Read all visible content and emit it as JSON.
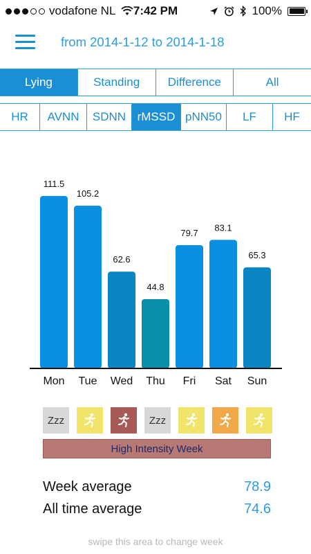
{
  "status_bar": {
    "carrier": "vodafone NL",
    "time": "7:42 PM",
    "battery": "100%",
    "signal_dots": 3,
    "signal_total": 5
  },
  "header": {
    "date_range": "from 2014-1-12 to 2014-1-18"
  },
  "position_tabs": [
    {
      "label": "Lying",
      "active": true
    },
    {
      "label": "Standing",
      "active": false
    },
    {
      "label": "Difference",
      "active": false
    },
    {
      "label": "All",
      "active": false
    }
  ],
  "metric_tabs": [
    {
      "label": "HR",
      "active": false
    },
    {
      "label": "AVNN",
      "active": false
    },
    {
      "label": "SDNN",
      "active": false
    },
    {
      "label": "rMSSD",
      "active": true
    },
    {
      "label": "pNN50",
      "active": false
    },
    {
      "label": "LF",
      "active": false
    },
    {
      "label": "HF",
      "active": false
    }
  ],
  "chart_data": {
    "type": "bar",
    "categories": [
      "Mon",
      "Tue",
      "Wed",
      "Thu",
      "Fri",
      "Sat",
      "Sun"
    ],
    "values": [
      111.5,
      105.2,
      62.6,
      44.8,
      79.7,
      83.1,
      65.3
    ],
    "value_labels": [
      "111.5",
      "105.2",
      "62.6",
      "44.8",
      "79.7",
      "83.1",
      "65.3"
    ],
    "colors": [
      "#0b8fe0",
      "#0b8fe0",
      "#0a86c2",
      "#0a8fa8",
      "#0b8fe0",
      "#0b8fe0",
      "#0a86c2"
    ],
    "ylim": [
      0,
      120
    ],
    "title": "",
    "xlabel": "",
    "ylabel": ""
  },
  "day_tiles": [
    {
      "type": "sleep",
      "label": "Zzz",
      "color": "#d8d8d8"
    },
    {
      "type": "run",
      "icon": "runner-icon",
      "color": "#f0e46a"
    },
    {
      "type": "run",
      "icon": "runner-icon",
      "color": "#a85a57"
    },
    {
      "type": "sleep",
      "label": "Zzz",
      "color": "#d8d8d8"
    },
    {
      "type": "run",
      "icon": "runner-icon",
      "color": "#f0e46a"
    },
    {
      "type": "run",
      "icon": "runner-icon",
      "color": "#f0a84a"
    },
    {
      "type": "run",
      "icon": "runner-icon",
      "color": "#f0e46a"
    }
  ],
  "banner": {
    "label": "High Intensity Week"
  },
  "stats": {
    "week_average_label": "Week average",
    "week_average_value": "78.9",
    "all_time_label": "All time average",
    "all_time_value": "74.6"
  },
  "footer": {
    "hint": "swipe this area to change week"
  },
  "colors": {
    "accent": "#1b8fd3",
    "banner": "#b87976"
  }
}
